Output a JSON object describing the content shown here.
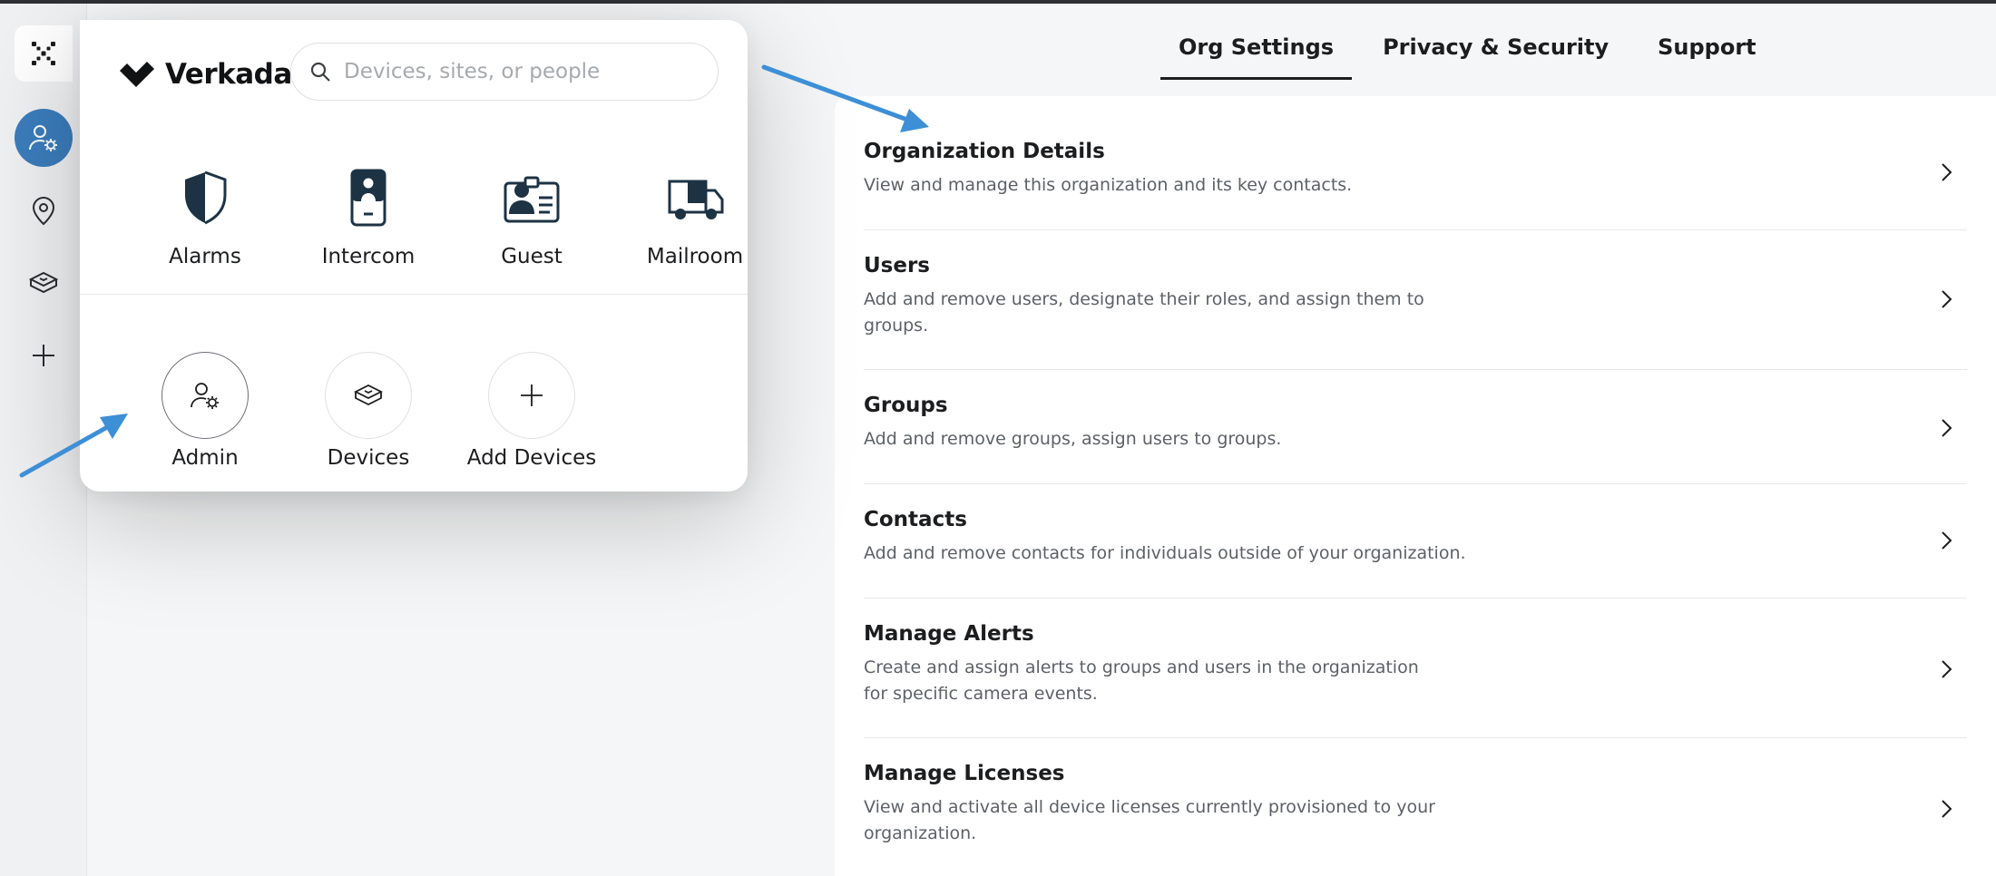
{
  "brand": {
    "name": "Verkada"
  },
  "search": {
    "placeholder": "Devices, sites, or people",
    "value": ""
  },
  "apps": [
    {
      "label": "Alarms",
      "icon": "shield-icon"
    },
    {
      "label": "Intercom",
      "icon": "intercom-icon"
    },
    {
      "label": "Guest",
      "icon": "guest-badge-icon"
    },
    {
      "label": "Mailroom",
      "icon": "delivery-truck-icon"
    }
  ],
  "tools": [
    {
      "label": "Admin",
      "icon": "user-gear-icon",
      "selected": true
    },
    {
      "label": "Devices",
      "icon": "device-box-icon",
      "selected": false
    },
    {
      "label": "Add Devices",
      "icon": "plus-icon",
      "selected": false
    }
  ],
  "rail": [
    {
      "name": "admin",
      "icon": "user-gear-icon",
      "active": true
    },
    {
      "name": "sites",
      "icon": "location-pin-icon",
      "active": false
    },
    {
      "name": "devices",
      "icon": "device-box-icon",
      "active": false
    },
    {
      "name": "add",
      "icon": "plus-icon",
      "active": false
    }
  ],
  "tabs": [
    {
      "label": "Org Settings",
      "active": true
    },
    {
      "label": "Privacy & Security",
      "active": false
    },
    {
      "label": "Support",
      "active": false
    }
  ],
  "settings": [
    {
      "title": "Organization Details",
      "description": "View and manage this organization and its key contacts."
    },
    {
      "title": "Users",
      "description": "Add and remove users, designate their roles, and assign them to groups."
    },
    {
      "title": "Groups",
      "description": "Add and remove groups, assign users to groups."
    },
    {
      "title": "Contacts",
      "description": "Add and remove contacts for individuals outside of your organization."
    },
    {
      "title": "Manage Alerts",
      "description": "Create and assign alerts to groups and users in the organization for specific camera events."
    },
    {
      "title": "Manage Licenses",
      "description": "View and activate all device licenses currently provisioned to your organization."
    }
  ],
  "colors": {
    "accent": "#3b7dbc",
    "annotation_arrow": "#3d8fd6",
    "icon_dark": "#1d3344",
    "text_primary": "#1c1d1f",
    "text_secondary": "#5d6167"
  }
}
